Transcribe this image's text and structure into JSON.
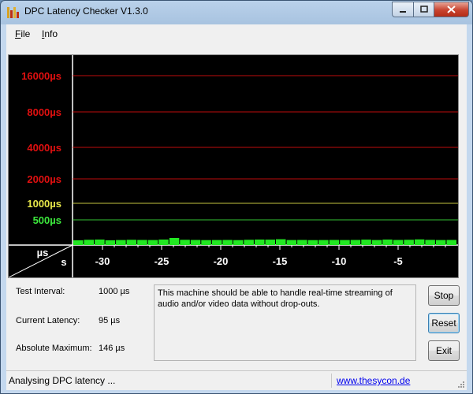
{
  "window": {
    "title": "DPC Latency Checker V1.3.0"
  },
  "menu": {
    "items": [
      {
        "underline": "F",
        "rest": "ile"
      },
      {
        "underline": "I",
        "rest": "nfo"
      }
    ]
  },
  "graph": {
    "latency_labels": [
      {
        "text": "16000µs",
        "color": "#e01010"
      },
      {
        "text": "8000µs",
        "color": "#e01010"
      },
      {
        "text": "4000µs",
        "color": "#e01010"
      },
      {
        "text": "2000µs",
        "color": "#e01010"
      },
      {
        "text": "1000µs",
        "color": "#e8e84a"
      },
      {
        "text": "500µs",
        "color": "#3ce83c"
      }
    ],
    "unit_y": "µs",
    "unit_x": "s",
    "time_ticks": [
      "-30",
      "-25",
      "-20",
      "-15",
      "-10",
      "-5"
    ],
    "bar_color": "#22e822",
    "bar_levels_us": [
      95,
      105,
      110,
      95,
      100,
      105,
      102,
      100,
      110,
      140,
      105,
      102,
      98,
      100,
      102,
      98,
      105,
      110,
      108,
      115,
      100,
      102,
      98,
      100,
      102,
      100,
      102,
      108,
      100,
      110,
      102,
      105,
      112,
      103,
      100,
      102
    ]
  },
  "info": {
    "test_interval_label": "Test Interval:",
    "test_interval_value": "1000 µs",
    "current_latency_label": "Current Latency:",
    "current_latency_value": "95 µs",
    "absolute_maximum_label": "Absolute Maximum:",
    "absolute_maximum_value": "146 µs"
  },
  "message": "This machine should be able to handle real-time streaming of audio and/or video data without drop-outs.",
  "buttons": {
    "stop": "Stop",
    "reset": "Reset",
    "exit": "Exit"
  },
  "status": {
    "text": "Analysing DPC latency ...",
    "link": "www.thesycon.de"
  }
}
